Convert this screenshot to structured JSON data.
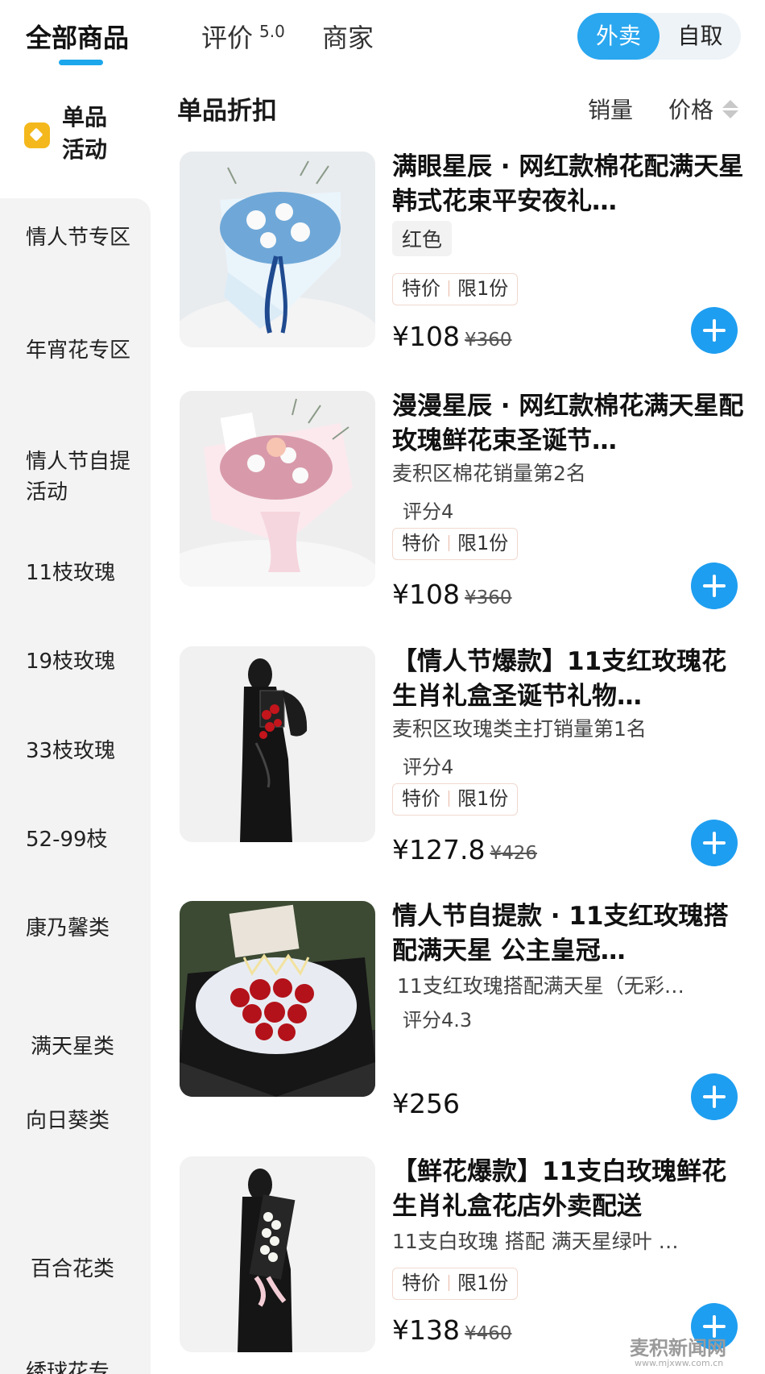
{
  "tabs": {
    "all_products": "全部商品",
    "reviews": "评价",
    "review_score": "5.0",
    "merchant": "商家"
  },
  "mode": {
    "delivery": "外卖",
    "pickup": "自取",
    "selected": "外卖"
  },
  "sidebar": {
    "promo_label": "单品活动",
    "items": [
      "情人节专区",
      "年宵花专区",
      "情人节自提活动",
      "11枝玫瑰",
      "19枝玫瑰",
      "33枝玫瑰",
      "52-99枝",
      "康乃馨类",
      "满天星类",
      "向日葵类",
      "百合花类",
      "绣球花专"
    ]
  },
  "section": {
    "title": "单品折扣",
    "sort_sales": "销量",
    "sort_price": "价格"
  },
  "products": [
    {
      "title": "满眼星辰 · 网红款棉花配满天星韩式花束平安夜礼…",
      "spec_tag": "红色",
      "badge_1": "特价",
      "badge_2": "限1份",
      "price": "¥108",
      "orig_price": "¥360",
      "image_icon": "blue-cotton-bouquet"
    },
    {
      "title": "漫漫星辰 · 网红款棉花满天星配玫瑰鲜花束圣诞节…",
      "subtitle": "麦积区棉花销量第2名",
      "rating": "评分4",
      "badge_1": "特价",
      "badge_2": "限1份",
      "price": "¥108",
      "orig_price": "¥360",
      "image_icon": "pink-cotton-bouquet"
    },
    {
      "title": "【情人节爆款】11支红玫瑰花生肖礼盒圣诞节礼物…",
      "subtitle": "麦积区玫瑰类主打销量第1名",
      "rating": "评分4",
      "badge_1": "特价",
      "badge_2": "限1份",
      "price": "¥127.8",
      "orig_price": "¥426",
      "image_icon": "red-rose-gift-box"
    },
    {
      "title": "情人节自提款 · 11支红玫瑰搭配满天星 公主皇冠…",
      "subtitle": "11支红玫瑰搭配满天星（无彩…",
      "rating": "评分4.3",
      "price": "¥256",
      "image_icon": "red-rose-crown-bouquet"
    },
    {
      "title": "【鲜花爆款】11支白玫瑰鲜花生肖礼盒花店外卖配送",
      "subtitle": "11支白玫瑰 搭配 满天星绿叶 …",
      "badge_1": "特价",
      "badge_2": "限1份",
      "price": "¥138",
      "orig_price": "¥460",
      "image_icon": "white-rose-gift-box"
    }
  ],
  "watermark": {
    "name": "麦积新闻网",
    "url": "www.mjxww.com.cn"
  },
  "colors": {
    "accent": "#1ca7ec",
    "add_button": "#1e9ef0",
    "sidebar_bg": "#f3f3f3",
    "promo_icon": "#f4b81c"
  }
}
